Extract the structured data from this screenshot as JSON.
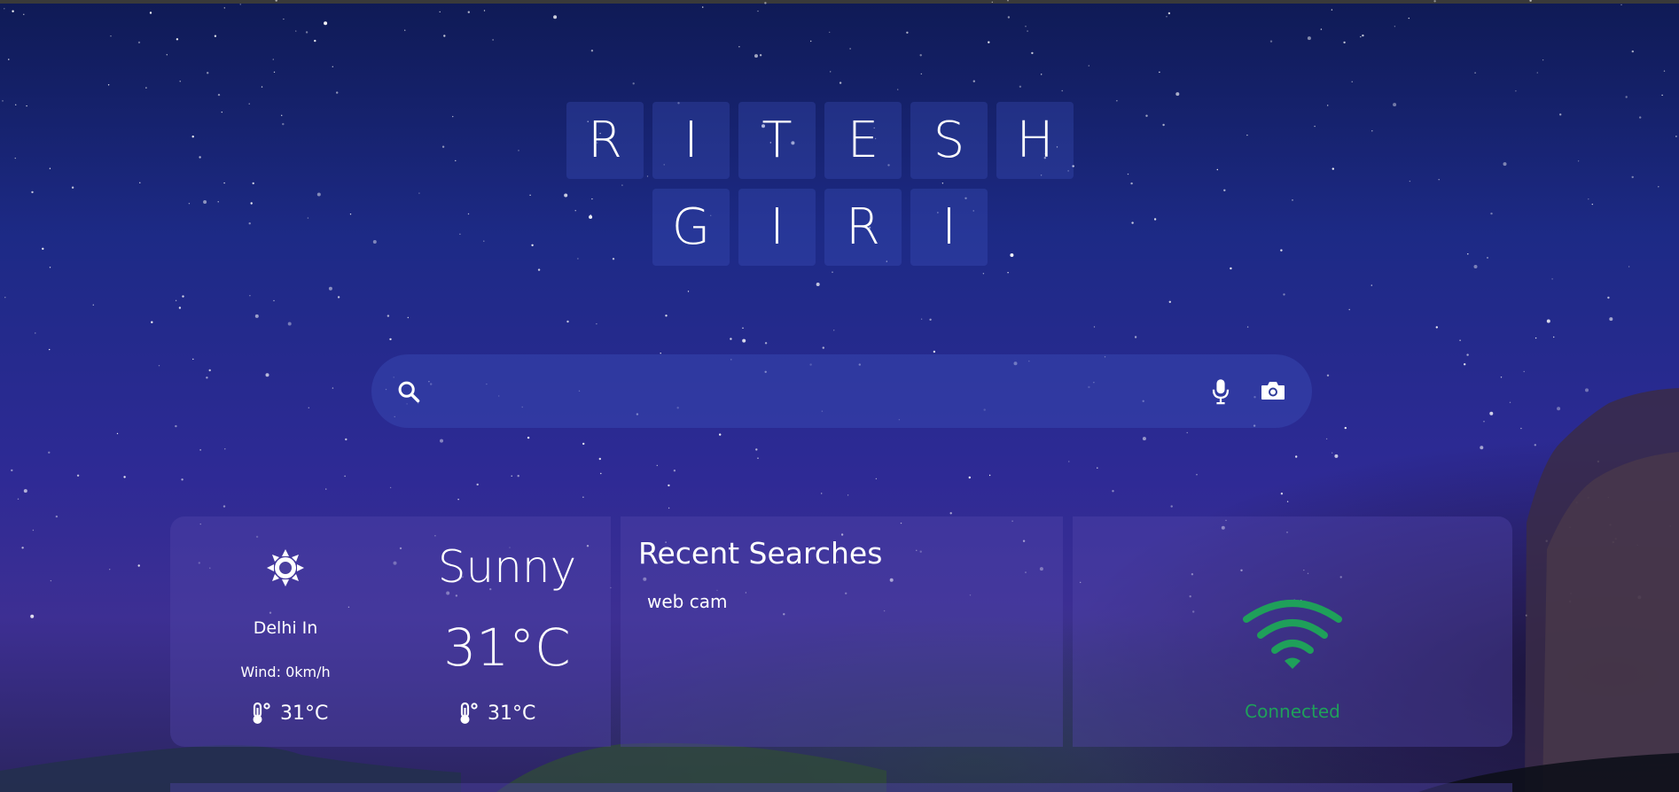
{
  "title": {
    "row1": [
      "R",
      "I",
      "T",
      "E",
      "S",
      "H"
    ],
    "row2": [
      "G",
      "I",
      "R",
      "I"
    ]
  },
  "search": {
    "value": "",
    "placeholder": "",
    "left_icon": "search-icon",
    "right_icons": [
      "mic-icon",
      "camera-icon"
    ]
  },
  "weather": {
    "icon": "sun-icon",
    "location": "Delhi In",
    "wind_label": "Wind:",
    "wind_value": "0km/h",
    "temp_left": "31°C",
    "condition": "Sunny",
    "temp_big": "31°C",
    "temp_right": "31°C"
  },
  "recent": {
    "title": "Recent Searches",
    "items": [
      "web cam"
    ]
  },
  "status": {
    "icon": "wifi-icon",
    "text": "Connected",
    "color": "#1fa05a"
  }
}
